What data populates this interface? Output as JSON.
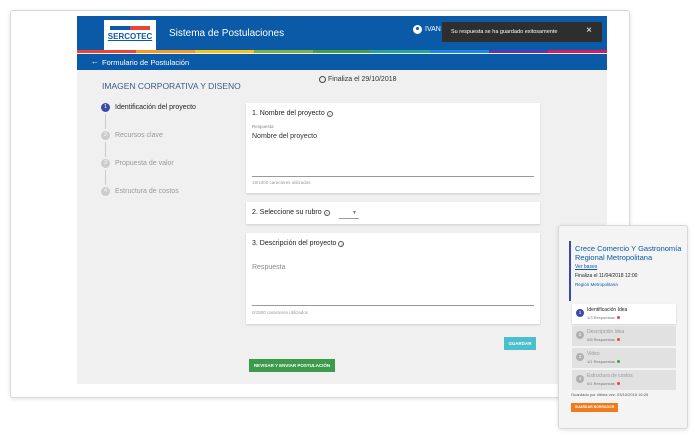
{
  "app": {
    "logo_text": "SERCOTEC",
    "title": "Sistema de Postulaciones",
    "user_name": "IVAN A",
    "subbar_title": "Formulario de Postulación",
    "back_icon": "arrow-left-icon",
    "colors": {
      "primary": "#0b5aa8",
      "bar": [
        "#e8463c",
        "#f29a21",
        "#f5c518",
        "#7cb342",
        "#43a047",
        "#26a69a",
        "#1e88e5",
        "#5e35b1",
        "#d81b60"
      ]
    }
  },
  "toast": {
    "message": "Su respuesta se ha guardado exitosamente",
    "close_icon": "close-icon"
  },
  "deadline": "Finaliza el 29/10/2018",
  "heading": "IMAGEN CORPORATIVA Y DISENO",
  "steps": [
    {
      "num": "1",
      "label": "Identificación del proyecto"
    },
    {
      "num": "2",
      "label": "Recursos clave"
    },
    {
      "num": "3",
      "label": "Propuesta de valor"
    },
    {
      "num": "4",
      "label": "Estructura de costos"
    }
  ],
  "questions": {
    "q1": {
      "title": "1. Nombre del proyecto",
      "answer_label": "Respuesta",
      "value": "Nombre del proyecto",
      "counter": "19/1000 caracteres utilizados"
    },
    "q2": {
      "title": "2. Seleccione su rubro"
    },
    "q3": {
      "title": "3. Descripción del proyecto",
      "placeholder": "Respuesta",
      "counter": "0/1500 caracteres utilizados"
    }
  },
  "buttons": {
    "save": "GUARDAR",
    "review": "REVISAR Y ENVIAR POSTULACIÓN"
  },
  "mobile": {
    "title": "Crece Comercio Y Gastronomía Regional Metropolitana",
    "link": "Ver bases",
    "date": "Finaliza el 11/04/2018 12:00",
    "region": "Región Metropolitana",
    "items": [
      {
        "num": "1",
        "label": "Identificación Idea",
        "sub": "1/3 Respuestas",
        "dot": "#e8463c"
      },
      {
        "num": "2",
        "label": "Descripción Idea",
        "sub": "0/6 Respuestas",
        "dot": "#e8463c"
      },
      {
        "num": "3",
        "label": "Video",
        "sub": "1/1 Respuestas",
        "dot": "#43a047"
      },
      {
        "num": "4",
        "label": "Estructura de costos",
        "sub": "0/1 Respuestas",
        "dot": "#e8463c"
      }
    ],
    "saved": "Guardado por última vez: 03/10/2018 16:25",
    "save_button": "GUARDAR BORRADOR"
  }
}
